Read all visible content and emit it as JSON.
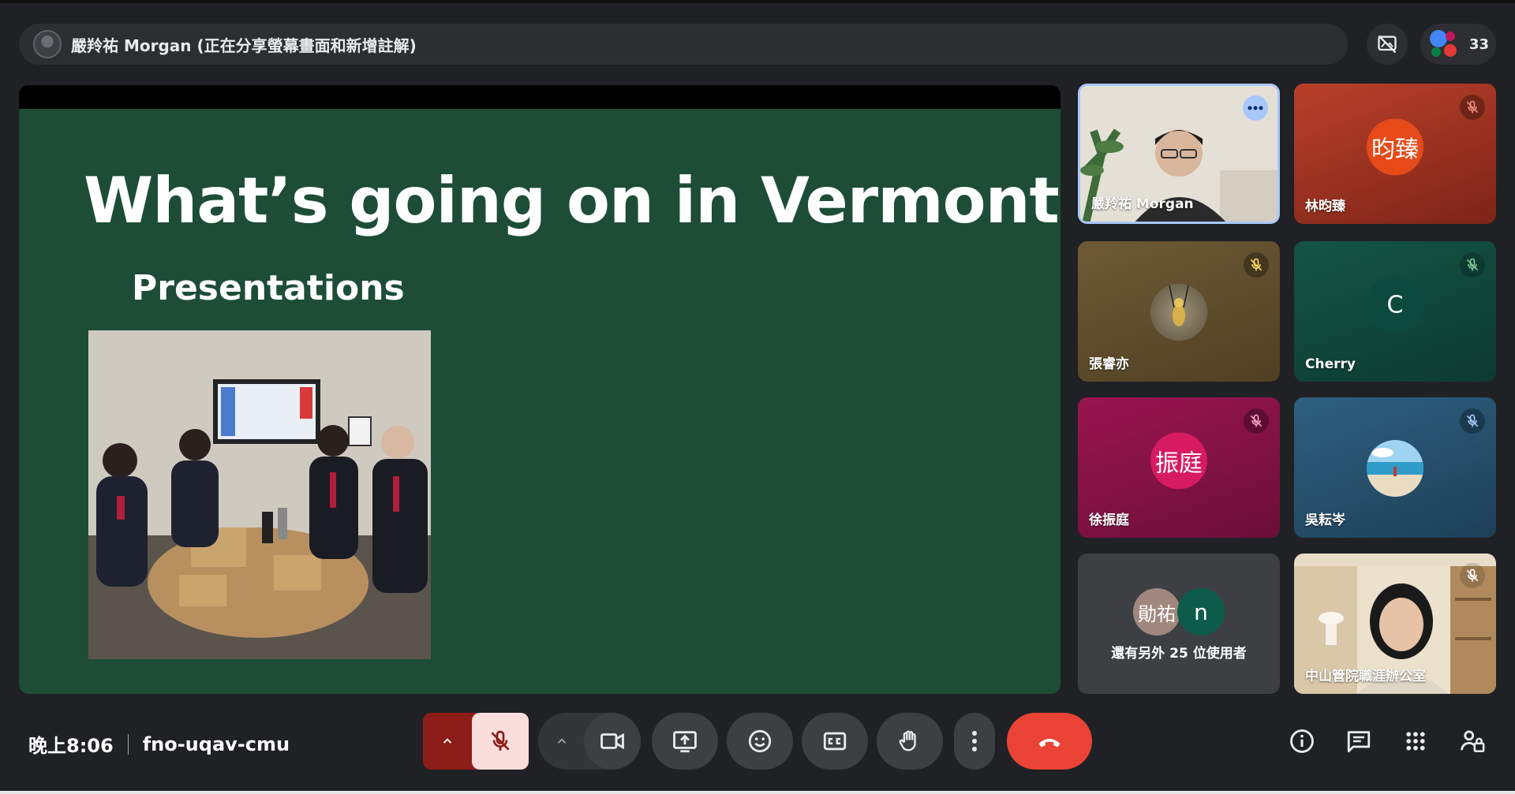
{
  "presenter_bar": {
    "text": "嚴羚祐 Morgan (正在分享螢幕畫面和新增註解)"
  },
  "participants": {
    "count": "33"
  },
  "slide": {
    "title": "What’s going on in Vermont?",
    "subtitle": "Presentations"
  },
  "tiles": [
    {
      "name": "嚴羚祐 Morgan"
    },
    {
      "name": "林昀臻",
      "initials": "昀臻",
      "color": "#d84315"
    },
    {
      "name": "張睿亦"
    },
    {
      "name": "Cherry",
      "initials": "C",
      "color": "#0b4a3c"
    },
    {
      "name": "徐振庭",
      "initials": "振庭",
      "color": "#c2185b"
    },
    {
      "name": "吳耘岑"
    },
    {
      "group_avatar_1": "勛祐",
      "group_avatar_2": "n",
      "more_label": "還有另外 25 位使用者"
    },
    {
      "name": "中山管院職涯辦公室"
    }
  ],
  "bottom_bar": {
    "time": "晚上8:06",
    "meeting_code": "fno-uqav-cmu"
  },
  "colors": {
    "background": "#202124",
    "slide_green": "#1d4d36",
    "end_call": "#ea4335",
    "mic_off_bg": "#f9dedc"
  },
  "icons": [
    "more-options-icon",
    "mic-off-icon",
    "camera-icon",
    "present-screen-icon",
    "emoji-icon",
    "captions-icon",
    "raise-hand-icon",
    "more-vert-icon",
    "end-call-icon",
    "info-icon",
    "chat-icon",
    "activities-icon",
    "host-controls-icon"
  ]
}
